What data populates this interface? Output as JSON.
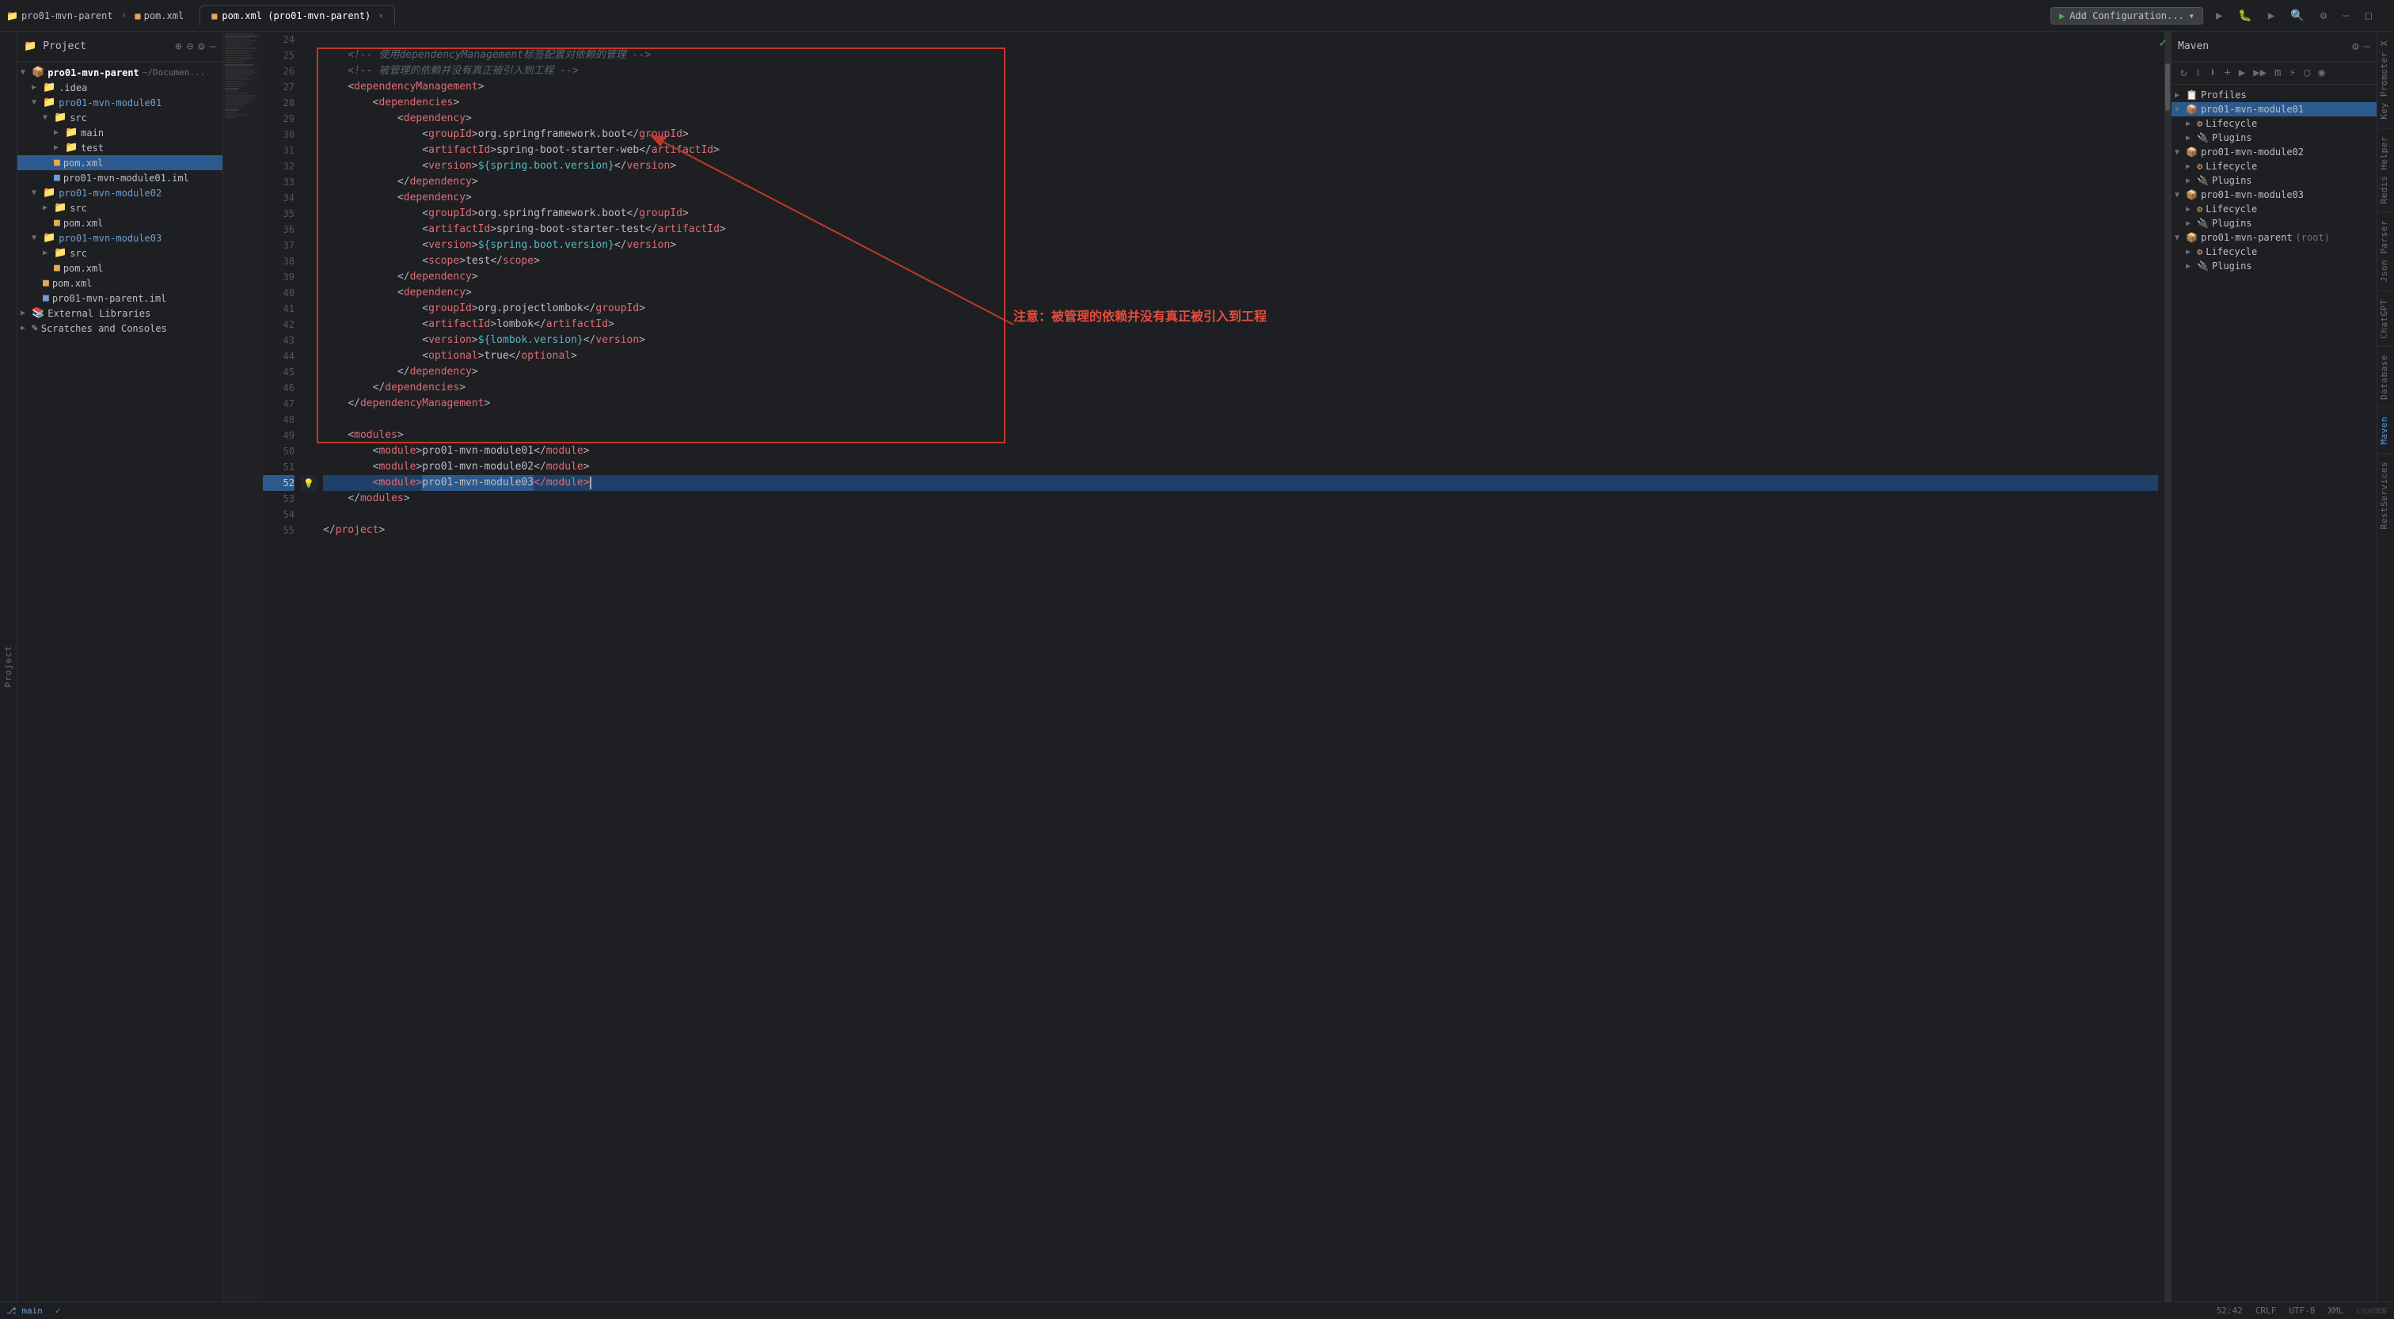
{
  "titleBar": {
    "breadcrumb1": "pro01-mvn-parent",
    "breadcrumb2": "pom.xml",
    "tab_label": "pom.xml (pro01-mvn-parent)",
    "run_config": "Add Configuration...",
    "close_btn": "×"
  },
  "projectPanel": {
    "title": "Project",
    "items": [
      {
        "id": "pro01-mvn-parent",
        "label": "pro01-mvn-parent",
        "path": "~/Documen...",
        "indent": 0,
        "type": "module",
        "expanded": true
      },
      {
        "id": "idea",
        "label": ".idea",
        "indent": 1,
        "type": "folder",
        "expanded": false
      },
      {
        "id": "pro01-mvn-module01",
        "label": "pro01-mvn-module01",
        "indent": 1,
        "type": "module-folder",
        "expanded": true
      },
      {
        "id": "src01",
        "label": "src",
        "indent": 2,
        "type": "folder",
        "expanded": true
      },
      {
        "id": "main",
        "label": "main",
        "indent": 3,
        "type": "folder"
      },
      {
        "id": "test",
        "label": "test",
        "indent": 3,
        "type": "folder"
      },
      {
        "id": "pom01",
        "label": "pom.xml",
        "indent": 2,
        "type": "xml",
        "selected": true
      },
      {
        "id": "iml01",
        "label": "pro01-mvn-module01.iml",
        "indent": 2,
        "type": "iml"
      },
      {
        "id": "pro01-mvn-module02",
        "label": "pro01-mvn-module02",
        "indent": 1,
        "type": "module-folder",
        "expanded": false
      },
      {
        "id": "src02",
        "label": "src",
        "indent": 2,
        "type": "folder"
      },
      {
        "id": "pom02",
        "label": "pom.xml",
        "indent": 2,
        "type": "xml"
      },
      {
        "id": "pro01-mvn-module03",
        "label": "pro01-mvn-module03",
        "indent": 1,
        "type": "module-folder",
        "expanded": true
      },
      {
        "id": "src03",
        "label": "src",
        "indent": 2,
        "type": "folder"
      },
      {
        "id": "pom03",
        "label": "pom.xml",
        "indent": 2,
        "type": "xml"
      },
      {
        "id": "pom-parent",
        "label": "pom.xml",
        "indent": 1,
        "type": "xml"
      },
      {
        "id": "iml-parent",
        "label": "pro01-mvn-parent.iml",
        "indent": 1,
        "type": "iml"
      },
      {
        "id": "ext-libs",
        "label": "External Libraries",
        "indent": 0,
        "type": "folder",
        "expanded": false
      },
      {
        "id": "scratches",
        "label": "Scratches and Consoles",
        "indent": 0,
        "type": "folder",
        "expanded": false
      }
    ]
  },
  "editor": {
    "lines": [
      {
        "num": 24,
        "content": "",
        "type": "empty"
      },
      {
        "num": 25,
        "content": "    <!-- 使用dependencyManagement标签配置对依赖的管理 -->",
        "type": "comment"
      },
      {
        "num": 26,
        "content": "    <!-- 被管理的依赖并没有真正被引入到工程 -->",
        "type": "comment"
      },
      {
        "num": 27,
        "content": "    <dependencyManagement>",
        "type": "code"
      },
      {
        "num": 28,
        "content": "        <dependencies>",
        "type": "code"
      },
      {
        "num": 29,
        "content": "            <dependency>",
        "type": "code"
      },
      {
        "num": 30,
        "content": "                <groupId>org.springframework.boot</groupId>",
        "type": "code"
      },
      {
        "num": 31,
        "content": "                <artifactId>spring-boot-starter-web</artifactId>",
        "type": "code"
      },
      {
        "num": 32,
        "content": "                <version>${spring.boot.version}</version>",
        "type": "code"
      },
      {
        "num": 33,
        "content": "            </dependency>",
        "type": "code"
      },
      {
        "num": 34,
        "content": "            <dependency>",
        "type": "code"
      },
      {
        "num": 35,
        "content": "                <groupId>org.springframework.boot</groupId>",
        "type": "code"
      },
      {
        "num": 36,
        "content": "                <artifactId>spring-boot-starter-test</artifactId>",
        "type": "code"
      },
      {
        "num": 37,
        "content": "                <version>${spring.boot.version}</version>",
        "type": "code"
      },
      {
        "num": 38,
        "content": "                <scope>test</scope>",
        "type": "code"
      },
      {
        "num": 39,
        "content": "            </dependency>",
        "type": "code"
      },
      {
        "num": 40,
        "content": "            <dependency>",
        "type": "code"
      },
      {
        "num": 41,
        "content": "                <groupId>org.projectlombok</groupId>",
        "type": "code"
      },
      {
        "num": 42,
        "content": "                <artifactId>lombok</artifactId>",
        "type": "code"
      },
      {
        "num": 43,
        "content": "                <version>${lombok.version}</version>",
        "type": "code"
      },
      {
        "num": 44,
        "content": "                <optional>true</optional>",
        "type": "code"
      },
      {
        "num": 45,
        "content": "            </dependency>",
        "type": "code"
      },
      {
        "num": 46,
        "content": "        </dependencies>",
        "type": "code"
      },
      {
        "num": 47,
        "content": "    </dependencyManagement>",
        "type": "code"
      },
      {
        "num": 48,
        "content": "",
        "type": "empty"
      },
      {
        "num": 49,
        "content": "    <modules>",
        "type": "code"
      },
      {
        "num": 50,
        "content": "        <module>pro01-mvn-module01</module>",
        "type": "code"
      },
      {
        "num": 51,
        "content": "        <module>pro01-mvn-module02</module>",
        "type": "code"
      },
      {
        "num": 52,
        "content": "        <module>pro01-mvn-module03</module>",
        "type": "code-selected"
      },
      {
        "num": 53,
        "content": "    </modules>",
        "type": "code"
      },
      {
        "num": 54,
        "content": "",
        "type": "empty"
      },
      {
        "num": 55,
        "content": "</project>",
        "type": "code"
      }
    ],
    "annotation": "注意：被管理的依赖并没有真正被引入到工程"
  },
  "mavenPanel": {
    "title": "Maven",
    "toolbar_btns": [
      "↻",
      "↓",
      "⬇",
      "+",
      "▶",
      "▶▶",
      "m",
      "⚡",
      "○",
      "◉"
    ],
    "items": [
      {
        "id": "profiles",
        "label": "Profiles",
        "indent": 0,
        "type": "folder",
        "expanded": false
      },
      {
        "id": "module01",
        "label": "pro01-mvn-module01",
        "indent": 0,
        "type": "maven-module",
        "expanded": true,
        "selected": true
      },
      {
        "id": "lifecycle01",
        "label": "Lifecycle",
        "indent": 1,
        "type": "lifecycle",
        "expanded": false
      },
      {
        "id": "plugins01",
        "label": "Plugins",
        "indent": 1,
        "type": "plugins",
        "expanded": false
      },
      {
        "id": "module02",
        "label": "pro01-mvn-module02",
        "indent": 0,
        "type": "maven-module",
        "expanded": true
      },
      {
        "id": "lifecycle02",
        "label": "Lifecycle",
        "indent": 1,
        "type": "lifecycle"
      },
      {
        "id": "plugins02",
        "label": "Plugins",
        "indent": 1,
        "type": "plugins"
      },
      {
        "id": "module03",
        "label": "pro01-mvn-module03",
        "indent": 0,
        "type": "maven-module",
        "expanded": true
      },
      {
        "id": "lifecycle03",
        "label": "Lifecycle",
        "indent": 1,
        "type": "lifecycle"
      },
      {
        "id": "plugins03",
        "label": "Plugins",
        "indent": 1,
        "type": "plugins"
      },
      {
        "id": "parent-root",
        "label": "pro01-mvn-parent",
        "indent": 0,
        "type": "maven-module",
        "expanded": true,
        "suffix": "(root)"
      },
      {
        "id": "lifecycle-parent",
        "label": "Lifecycle",
        "indent": 1,
        "type": "lifecycle"
      },
      {
        "id": "plugins-parent",
        "label": "Plugins",
        "indent": 1,
        "type": "plugins"
      }
    ]
  },
  "sidebarTabs": [
    {
      "id": "key-promoter",
      "label": "Key Promoter X"
    },
    {
      "id": "redis-helper",
      "label": "Redis Helper"
    },
    {
      "id": "json-parser",
      "label": "Json Parser"
    },
    {
      "id": "chatgpt",
      "label": "ChatGPT"
    },
    {
      "id": "database",
      "label": "Database"
    },
    {
      "id": "maven-side",
      "label": "Maven"
    },
    {
      "id": "rest-services",
      "label": "RestServices"
    }
  ],
  "bottomBar": {
    "encoding": "UTF-8",
    "line_info": "52:42",
    "crlf": "CRLF",
    "lang": "XML",
    "git": "main"
  }
}
